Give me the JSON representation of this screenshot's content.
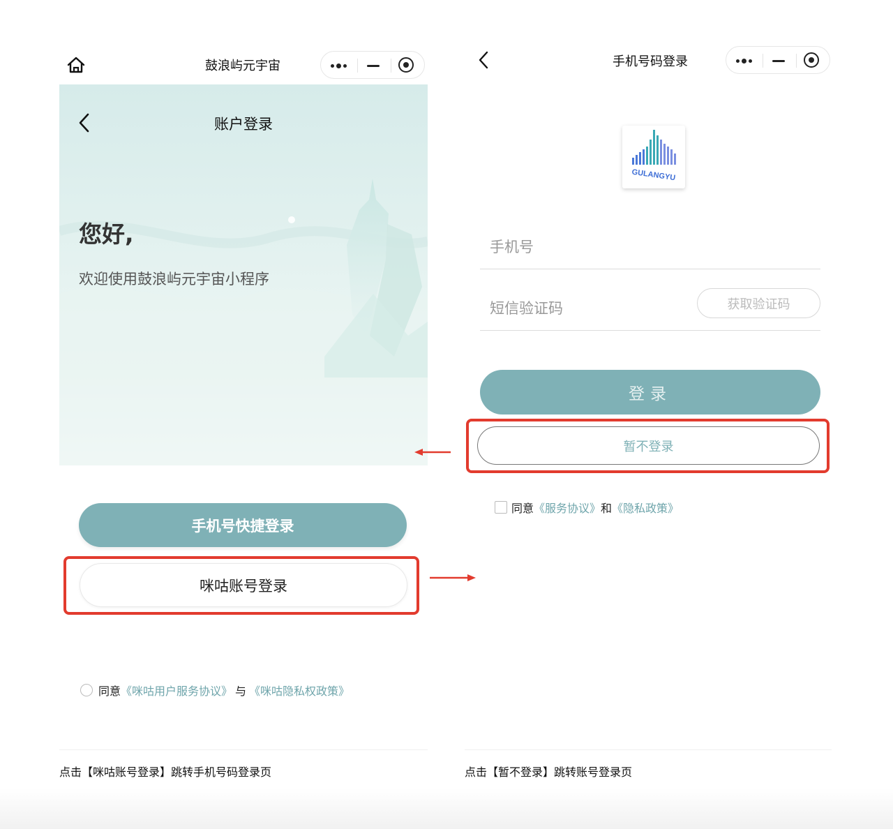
{
  "left_screen": {
    "miniprogram_title": "鼓浪屿元宇宙",
    "header_title": "账户登录",
    "greeting": "您好,",
    "welcome_text": "欢迎使用鼓浪屿元宇宙小程序",
    "phone_quick_login_label": "手机号快捷登录",
    "migu_login_label": "咪咕账号登录",
    "agreement": {
      "prefix": "同意",
      "link1": "《咪咕用户服务协议》",
      "connector": "与",
      "link2": "《咪咕隐私权政策》"
    },
    "icons": [
      "home-icon",
      "back-icon",
      "more-dots-icon",
      "minimize-icon",
      "close-target-icon"
    ]
  },
  "right_screen": {
    "header_title": "手机号码登录",
    "logo_text": "GULANGYU",
    "phone_placeholder": "手机号",
    "sms_placeholder": "短信验证码",
    "get_code_label": "获取验证码",
    "login_label": "登录",
    "skip_login_label": "暂不登录",
    "agreement": {
      "prefix": "同意",
      "link1": "《服务协议》",
      "connector": "和",
      "link2": "《隐私政策》"
    }
  },
  "captions": {
    "left": "点击【咪咕账号登录】跳转手机号码登录页",
    "right": "点击【暂不登录】跳转账号登录页"
  },
  "colors": {
    "accent": "#7fb1b6",
    "highlight_red": "#e23b2e",
    "link": "#6fa5ab"
  }
}
